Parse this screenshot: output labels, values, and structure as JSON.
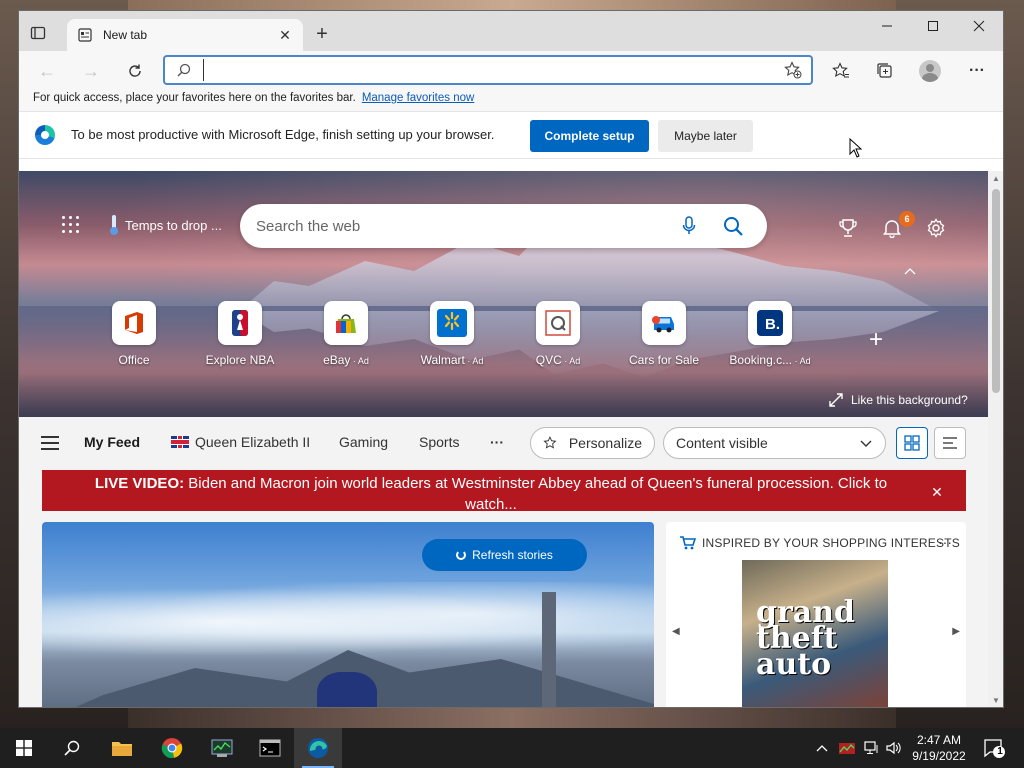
{
  "browser": {
    "tab": {
      "title": "New tab"
    },
    "address_bar": {
      "value": "",
      "placeholder": ""
    },
    "favorites_bar": {
      "text": "For quick access, place your favorites here on the favorites bar.",
      "link": "Manage favorites now"
    },
    "setup_banner": {
      "message": "To be most productive with Microsoft Edge, finish setting up your browser.",
      "primary_button": "Complete setup",
      "secondary_button": "Maybe later"
    }
  },
  "ntp": {
    "weather_text": "Temps to drop ...",
    "search_placeholder": "Search the web",
    "notification_count": "6",
    "quick_links": [
      {
        "label": "Office",
        "ad": "",
        "icon": "office-icon",
        "color": "#d83b01"
      },
      {
        "label": "Explore NBA",
        "ad": "",
        "icon": "nba-icon",
        "color": "#1d428a"
      },
      {
        "label": "eBay",
        "ad": " · Ad",
        "icon": "ebay-icon",
        "color": "#e53238"
      },
      {
        "label": "Walmart",
        "ad": " · Ad",
        "icon": "walmart-icon",
        "color": "#0071ce"
      },
      {
        "label": "QVC",
        "ad": " · Ad",
        "icon": "qvc-icon",
        "color": "#d04a3c"
      },
      {
        "label": "Cars for Sale",
        "ad": "",
        "icon": "car-icon",
        "color": "#0a74da"
      },
      {
        "label": "Booking.c...",
        "ad": " · Ad",
        "icon": "booking-icon",
        "color": "#003580"
      }
    ],
    "like_background": "Like this background?",
    "feed": {
      "tabs": [
        "My Feed",
        "Queen Elizabeth II",
        "Gaming",
        "Sports"
      ],
      "more": "···",
      "personalize": "Personalize",
      "content_visibility": "Content visible"
    },
    "live_banner": {
      "prefix": "LIVE VIDEO:",
      "text": " Biden and Macron join world leaders at Westminster Abbey ahead of Queen's funeral procession. Click to watch..."
    },
    "refresh_stories": "Refresh stories",
    "shopping_card": {
      "header": "INSPIRED BY YOUR SHOPPING INTERESTS",
      "product_text": "grand theft auto"
    }
  },
  "taskbar": {
    "time": "2:47 AM",
    "date": "9/19/2022",
    "notification_count": "1"
  },
  "colors": {
    "accent": "#0067c0",
    "live_red": "#b3171f",
    "badge_orange": "#e66b1f"
  }
}
